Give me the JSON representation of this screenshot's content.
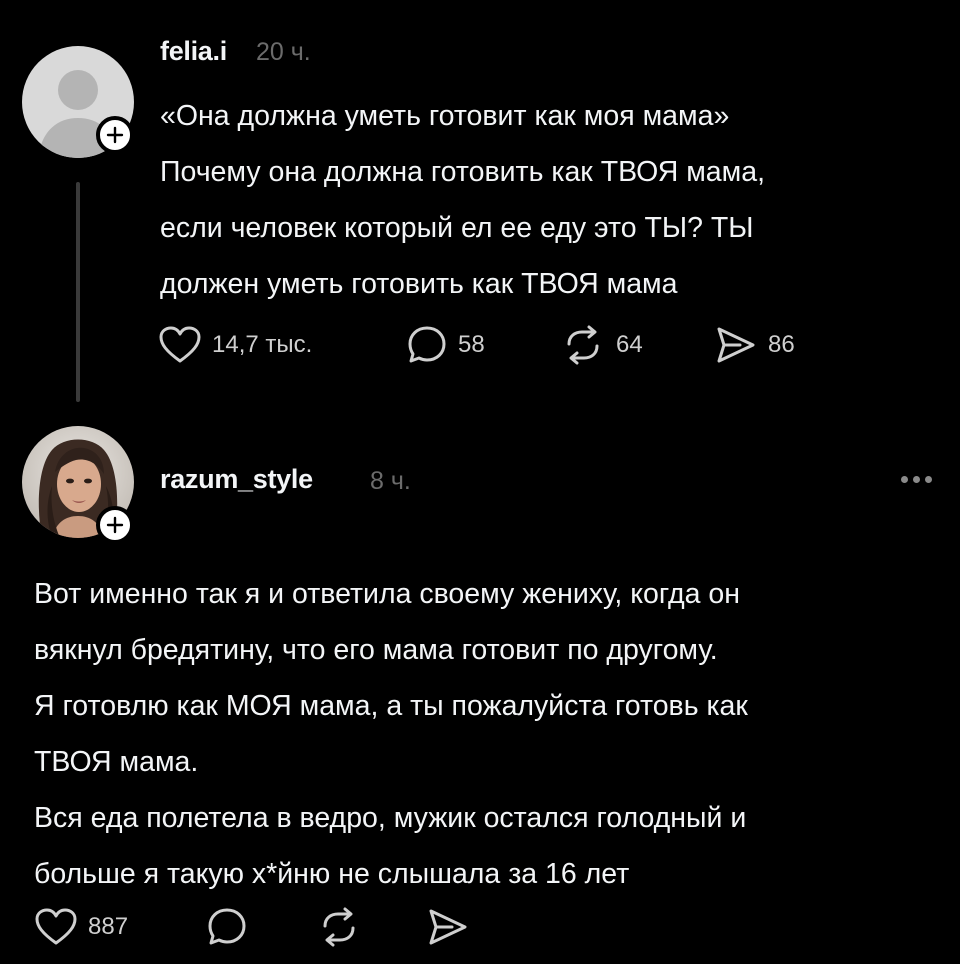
{
  "post1": {
    "username": "felia.i",
    "time": "20 ч.",
    "lines": [
      "«Она должна уметь готовит как моя мама»",
      "Почему она должна готовить как ТВОЯ мама,",
      "если человек который ел ее еду это ТЫ? ТЫ",
      "должен уметь готовить как ТВОЯ мама"
    ],
    "actions": {
      "likes": "14,7 тыс.",
      "comments": "58",
      "reposts": "64",
      "shares": "86"
    }
  },
  "post2": {
    "username": "razum_style",
    "time": "8 ч.",
    "lines": [
      "Вот именно так я и ответила своему жениху, когда он",
      "вякнул бредятину, что его мама готовит по другому.",
      "Я готовлю как МОЯ мама, а ты пожалуйста готовь как",
      "ТВОЯ мама.",
      "Вся еда полетела в ведро, мужик остался голодный и",
      "больше я такую х*йню не слышала за 16 лет"
    ],
    "actions": {
      "likes": "887"
    }
  },
  "icons": {
    "heart": "heart-icon",
    "comment": "comment-icon",
    "repost": "repost-icon",
    "share": "share-icon",
    "more": "more-icon",
    "follow": "plus-icon"
  },
  "colors": {
    "background": "#000000",
    "text": "#f3f5f7",
    "muted": "#6b6b6b",
    "thread_line": "#3a3a3a"
  }
}
